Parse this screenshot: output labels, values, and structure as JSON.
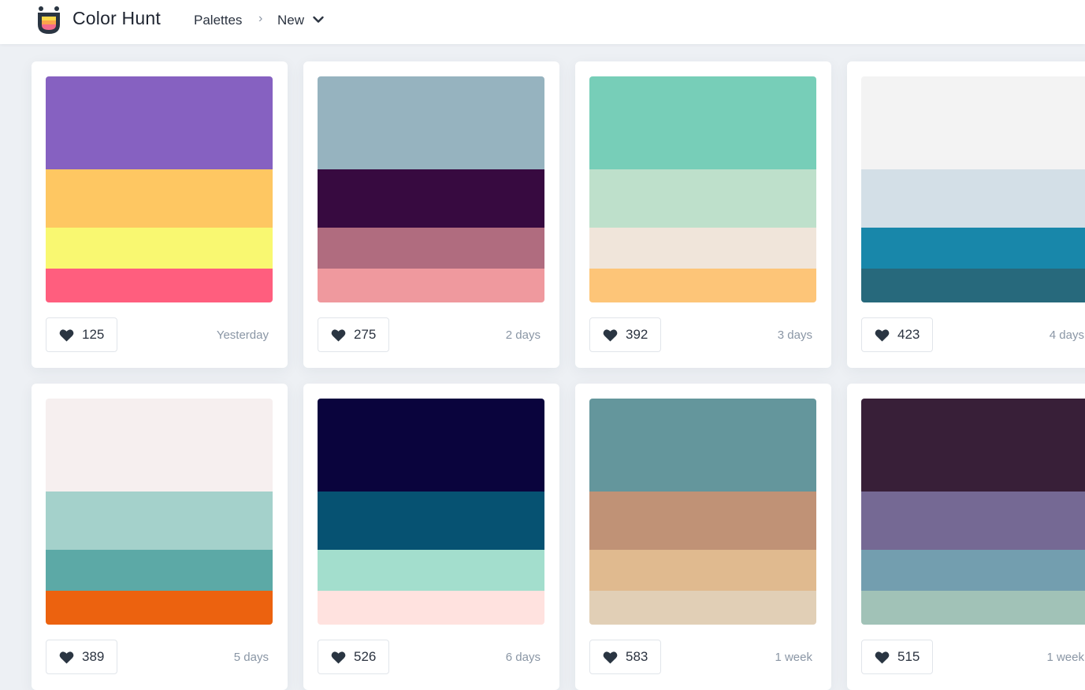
{
  "header": {
    "brand": "Color Hunt",
    "nav_palettes": "Palettes",
    "separator": "›",
    "nav_sort": "New"
  },
  "palettes": [
    {
      "colors": [
        "#8661C1",
        "#FEC762",
        "#F9F871",
        "#FF5E7E"
      ],
      "likes": "125",
      "date": "Yesterday"
    },
    {
      "colors": [
        "#96B3BF",
        "#370A40",
        "#B06C7F",
        "#EF999E"
      ],
      "likes": "275",
      "date": "2 days"
    },
    {
      "colors": [
        "#77CEB8",
        "#BEE0CB",
        "#F0E5DA",
        "#FDC578"
      ],
      "likes": "392",
      "date": "3 days"
    },
    {
      "colors": [
        "#F3F3F3",
        "#D3DFE7",
        "#1887AA",
        "#27697C"
      ],
      "likes": "423",
      "date": "4 days"
    },
    {
      "colors": [
        "#F6EFEF",
        "#A4D1CB",
        "#5CA9A6",
        "#EC620F"
      ],
      "likes": "389",
      "date": "5 days"
    },
    {
      "colors": [
        "#0A043D",
        "#065272",
        "#A3DECD",
        "#FFE2DF"
      ],
      "likes": "526",
      "date": "6 days"
    },
    {
      "colors": [
        "#64969C",
        "#C09276",
        "#E0BA8F",
        "#E1CFB6"
      ],
      "likes": "583",
      "date": "1 week"
    },
    {
      "colors": [
        "#381F38",
        "#756994",
        "#739EAF",
        "#A1C2B7"
      ],
      "likes": "515",
      "date": "1 week"
    }
  ]
}
